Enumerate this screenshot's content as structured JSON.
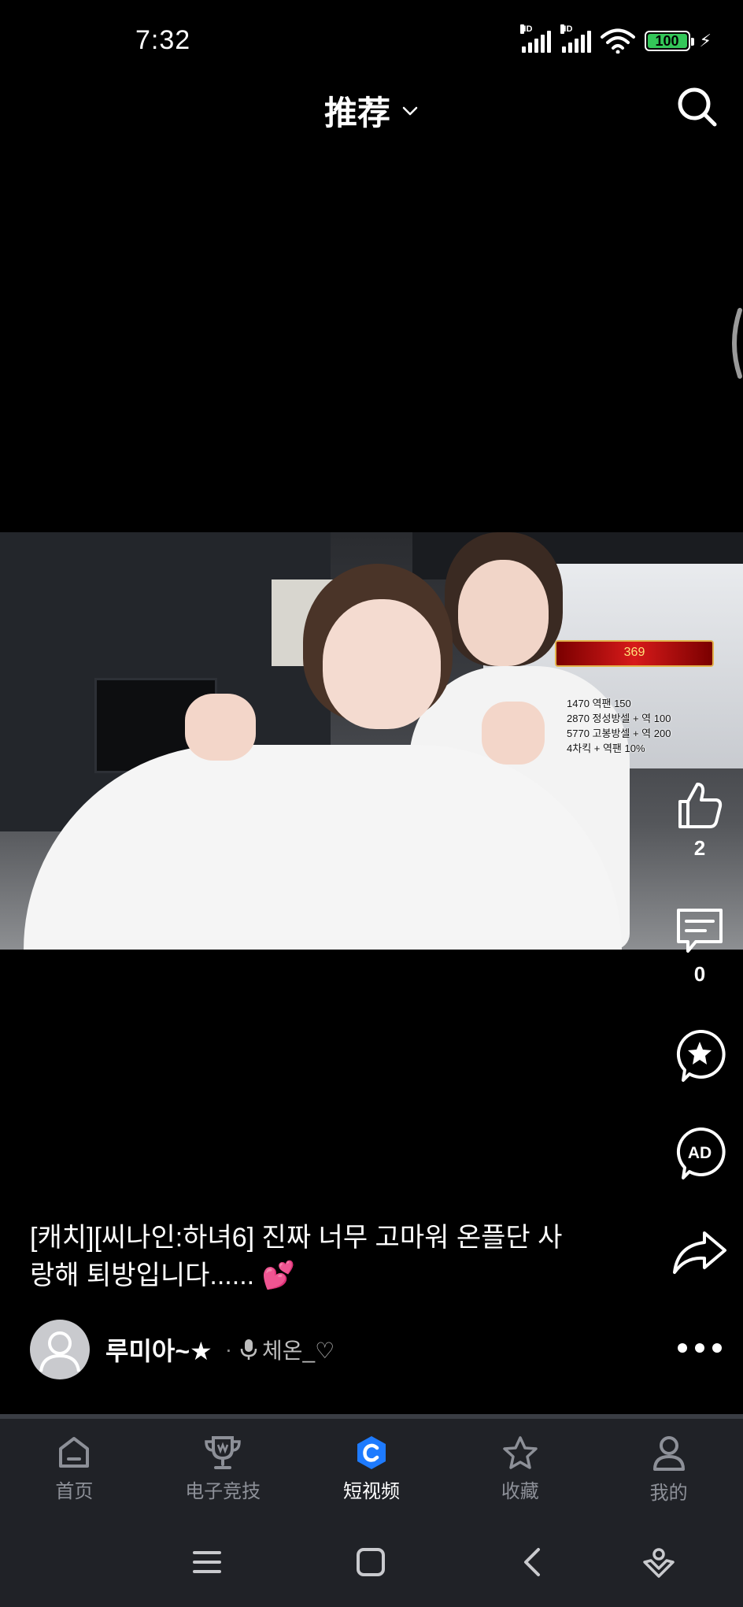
{
  "status_bar": {
    "time": "7:32",
    "signal_label_1": "HD",
    "signal_label_2": "HD",
    "battery": "100",
    "icons": [
      "signal-icon",
      "signal-icon",
      "wifi-icon",
      "battery-icon",
      "charging-icon"
    ]
  },
  "header": {
    "title": "推荐",
    "dropdown_icon": "chevron-down-icon",
    "search_icon": "search-icon"
  },
  "video_overlay": {
    "banner_value": "369",
    "lines": [
      "1470 역팬 150",
      "2870 정성방셀 + 역 100",
      "5770 고봉방셀 + 역 200",
      "4차킥 + 역팬 10%"
    ]
  },
  "actions": {
    "like_count": "2",
    "comment_count": "0",
    "icons": [
      "thumbs-up-icon",
      "comment-icon",
      "favorite-star-icon",
      "ad-icon",
      "share-icon",
      "more-icon"
    ]
  },
  "post": {
    "caption": "[캐치][씨나인:하녀6] 진짜 너무 고마워 온플단 사랑해 퇴방입니다......",
    "caption_emoji": "💕",
    "author": "루미아~★",
    "sub_author": "체온_♡"
  },
  "bottom_nav": {
    "items": [
      {
        "label": "首页",
        "icon": "home-icon"
      },
      {
        "label": "电子竞技",
        "icon": "trophy-icon"
      },
      {
        "label": "短视频",
        "icon": "short-video-icon",
        "active": true
      },
      {
        "label": "收藏",
        "icon": "star-icon"
      },
      {
        "label": "我的",
        "icon": "profile-icon"
      }
    ]
  },
  "colors": {
    "background": "#000000",
    "nav_background": "#202227",
    "active_nav": "#ffffff",
    "inactive_nav": "#8d9098",
    "brand_blue": "#1e7bff",
    "battery_green": "#34c759"
  }
}
